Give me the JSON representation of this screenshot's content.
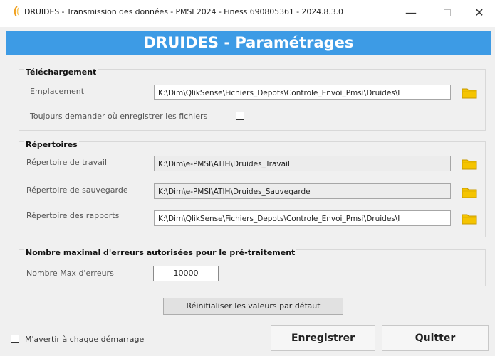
{
  "window": {
    "title": "DRUIDES - Transmission des données - PMSI 2024 -  Finess 690805361 - 2024.8.3.0",
    "minimize": "—",
    "close": "✕"
  },
  "banner": {
    "title": "DRUIDES - Paramétrages"
  },
  "telechargement": {
    "title": "Téléchargement",
    "emplacement_label": "Emplacement",
    "emplacement_value": "K:\\Dim\\QlikSense\\Fichiers_Depots\\Controle_Envoi_Pmsi\\Druides\\I",
    "always_ask_label": "Toujours demander où enregistrer les fichiers",
    "always_ask_checked": false
  },
  "repertoires": {
    "title": "Répertoires",
    "travail_label": "Répertoire de travail",
    "travail_value": "K:\\Dim\\e-PMSI\\ATIH\\Druides_Travail",
    "sauvegarde_label": "Répertoire de sauvegarde",
    "sauvegarde_value": "K:\\Dim\\e-PMSI\\ATIH\\Druides_Sauvegarde",
    "rapports_label": "Répertoire des rapports",
    "rapports_value": "K:\\Dim\\QlikSense\\Fichiers_Depots\\Controle_Envoi_Pmsi\\Druides\\I"
  },
  "erreurs": {
    "title": "Nombre maximal d'erreurs autorisées pour le pré-traitement",
    "max_label": "Nombre Max d'erreurs",
    "max_value": "10000"
  },
  "actions": {
    "reset_label": "Réinitialiser les valeurs par défaut",
    "warn_label": "M'avertir à chaque démarrage",
    "warn_checked": false,
    "save_label": "Enregistrer",
    "quit_label": "Quitter"
  },
  "colors": {
    "banner": "#3d9be5",
    "folder": "#f5c400"
  },
  "icons": {
    "app": "app-icon",
    "folder": "folder-icon"
  }
}
